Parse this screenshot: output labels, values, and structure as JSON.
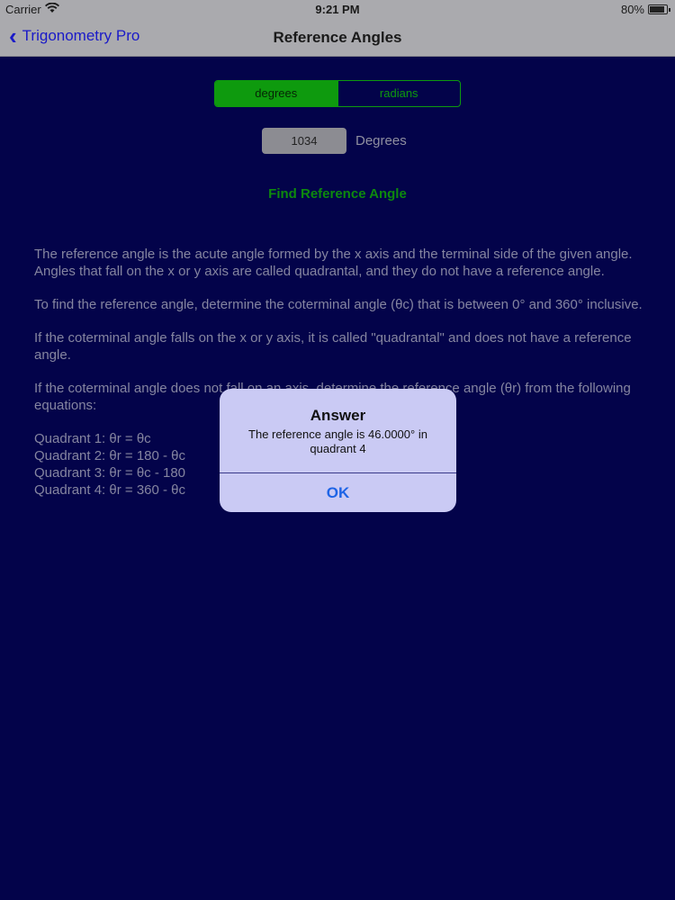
{
  "status": {
    "carrier": "Carrier",
    "time": "9:21 PM",
    "battery": "80%",
    "battery_level": 0.8
  },
  "nav": {
    "back_label": "Trigonometry Pro",
    "title": "Reference Angles"
  },
  "segment": {
    "options": [
      "degrees",
      "radians"
    ],
    "selected": "degrees"
  },
  "input": {
    "value": "1034",
    "unit": "Degrees"
  },
  "find_button": "Find Reference Angle",
  "explanation": {
    "p1": "The reference angle is the acute angle formed by the x axis and the terminal side of the given angle. Angles that fall on the x or y axis are called quadrantal, and they do not have a reference angle.",
    "p2": "To find the reference angle, determine the coterminal angle (θc) that is between 0° and 360° inclusive.",
    "p3": "If the coterminal angle falls on the x or y axis, it is called \"quadrantal\" and does not have a reference angle.",
    "p4": "If the coterminal angle does not fall on an axis, determine the reference angle (θr) from the following equations:",
    "quadrants": [
      "Quadrant 1: θr = θc",
      "Quadrant 2: θr = 180 - θc",
      "Quadrant 3: θr = θc - 180",
      "Quadrant 4: θr = 360 - θc"
    ]
  },
  "alert": {
    "title": "Answer",
    "message": "The reference angle is 46.0000° in quadrant 4",
    "ok_label": "OK"
  },
  "colors": {
    "background": "#03034a",
    "accent_green": "#0e9a0e",
    "alert_bg": "#cacaf4",
    "link_blue": "#1e64e6"
  }
}
